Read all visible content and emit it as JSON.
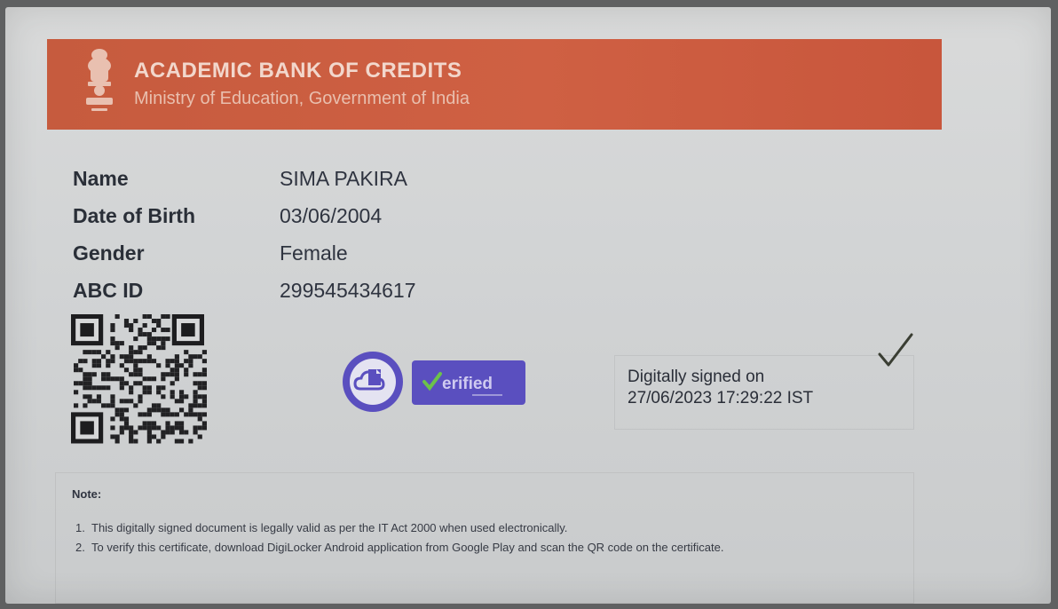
{
  "header": {
    "title": "ACADEMIC BANK OF CREDITS",
    "subtitle": "Ministry of Education, Government of India",
    "color": "#c65b3e"
  },
  "fields": [
    {
      "label": "Name",
      "value": "SIMA PAKIRA"
    },
    {
      "label": "Date of Birth",
      "value": "03/06/2004"
    },
    {
      "label": "Gender",
      "value": "Female"
    },
    {
      "label": "ABC ID",
      "value": "299545434617"
    }
  ],
  "badge": {
    "text": "erified",
    "icon": "digilocker-cloud-icon",
    "color": "#5a4fbf"
  },
  "signature": {
    "line1": "Digitally signed on",
    "line2": "27/06/2023 17:29:22 IST",
    "icon": "checkmark-icon"
  },
  "note": {
    "title": "Note:",
    "items": [
      {
        "num": "1.",
        "text": "This digitally signed document is legally valid as per the IT Act 2000 when used electronically."
      },
      {
        "num": "2.",
        "text": "To verify this certificate, download DigiLocker Android application from Google Play and scan the QR code on the certificate."
      }
    ]
  }
}
